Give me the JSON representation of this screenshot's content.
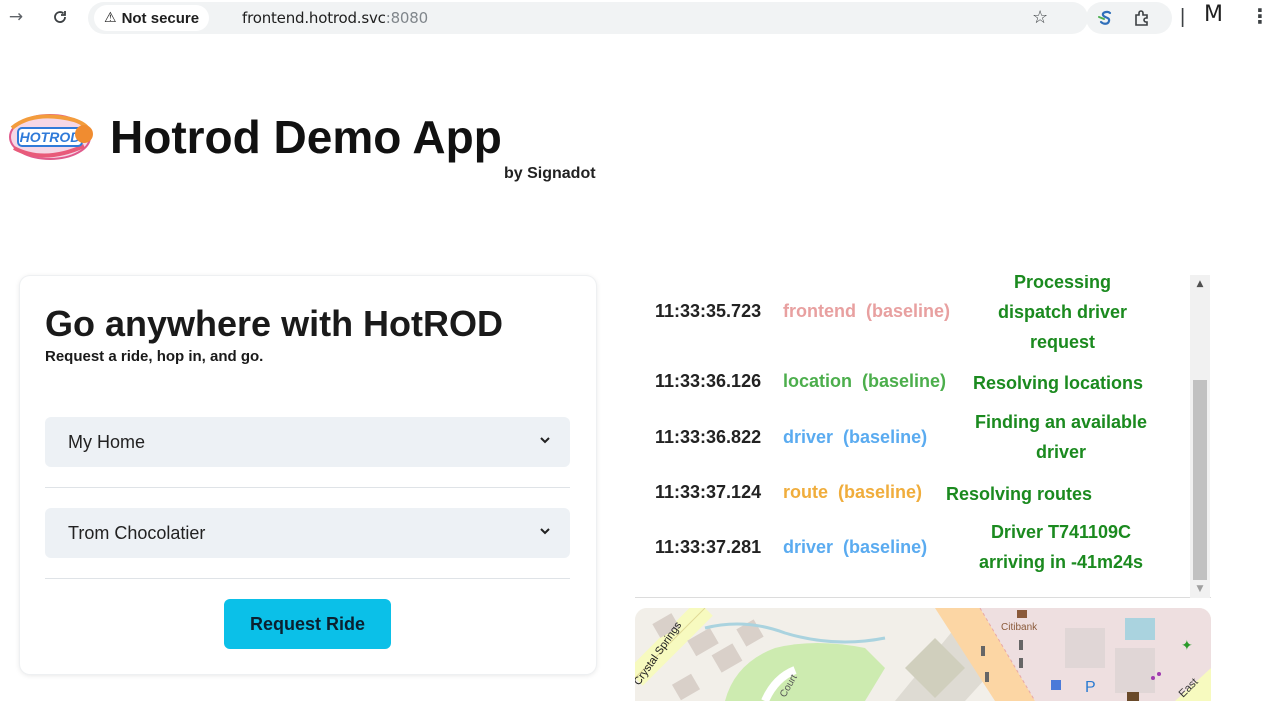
{
  "browser": {
    "back_icon": "arrow-right-icon",
    "reload_icon": "reload-icon",
    "security_label": "Not secure",
    "url_host": "frontend.hotrod.svc",
    "url_port": ":8080",
    "profile_initial": "M"
  },
  "header": {
    "title": "Hotrod Demo App",
    "byline": "by Signadot"
  },
  "card": {
    "title": "Go anywhere with HotROD",
    "subtitle": "Request a ride, hop in, and go.",
    "pickup_value": "My Home",
    "dropoff_value": "Trom Chocolatier",
    "request_button": "Request Ride"
  },
  "log": {
    "entries": [
      {
        "time": "11:33:35.723",
        "service": "frontend",
        "tag": "(baseline)",
        "message_lines": [
          "Processing",
          "dispatch driver",
          "request"
        ],
        "color": "#e8a0a0"
      },
      {
        "time": "11:33:36.126",
        "service": "location",
        "tag": "(baseline)",
        "message_lines": [
          "Resolving locations"
        ],
        "color": "#4cae4c"
      },
      {
        "time": "11:33:36.822",
        "service": "driver",
        "tag": "(baseline)",
        "message_lines": [
          "Finding an available",
          "driver"
        ],
        "color": "#5aabf0"
      },
      {
        "time": "11:33:37.124",
        "service": "route",
        "tag": "(baseline)",
        "message_lines": [
          "Resolving routes"
        ],
        "color": "#f0ad3c"
      },
      {
        "time": "11:33:37.281",
        "service": "driver",
        "tag": "(baseline)",
        "message_lines": [
          "Driver T741109C",
          "arriving in -41m24s"
        ],
        "color": "#5aabf0"
      }
    ]
  },
  "map": {
    "labels": [
      "Crystal Springs",
      "Citibank",
      "East",
      "P"
    ]
  },
  "colors": {
    "message_green": "#1b8a1f",
    "button_cyan": "#0bc0e8",
    "select_bg": "#edf1f5"
  }
}
